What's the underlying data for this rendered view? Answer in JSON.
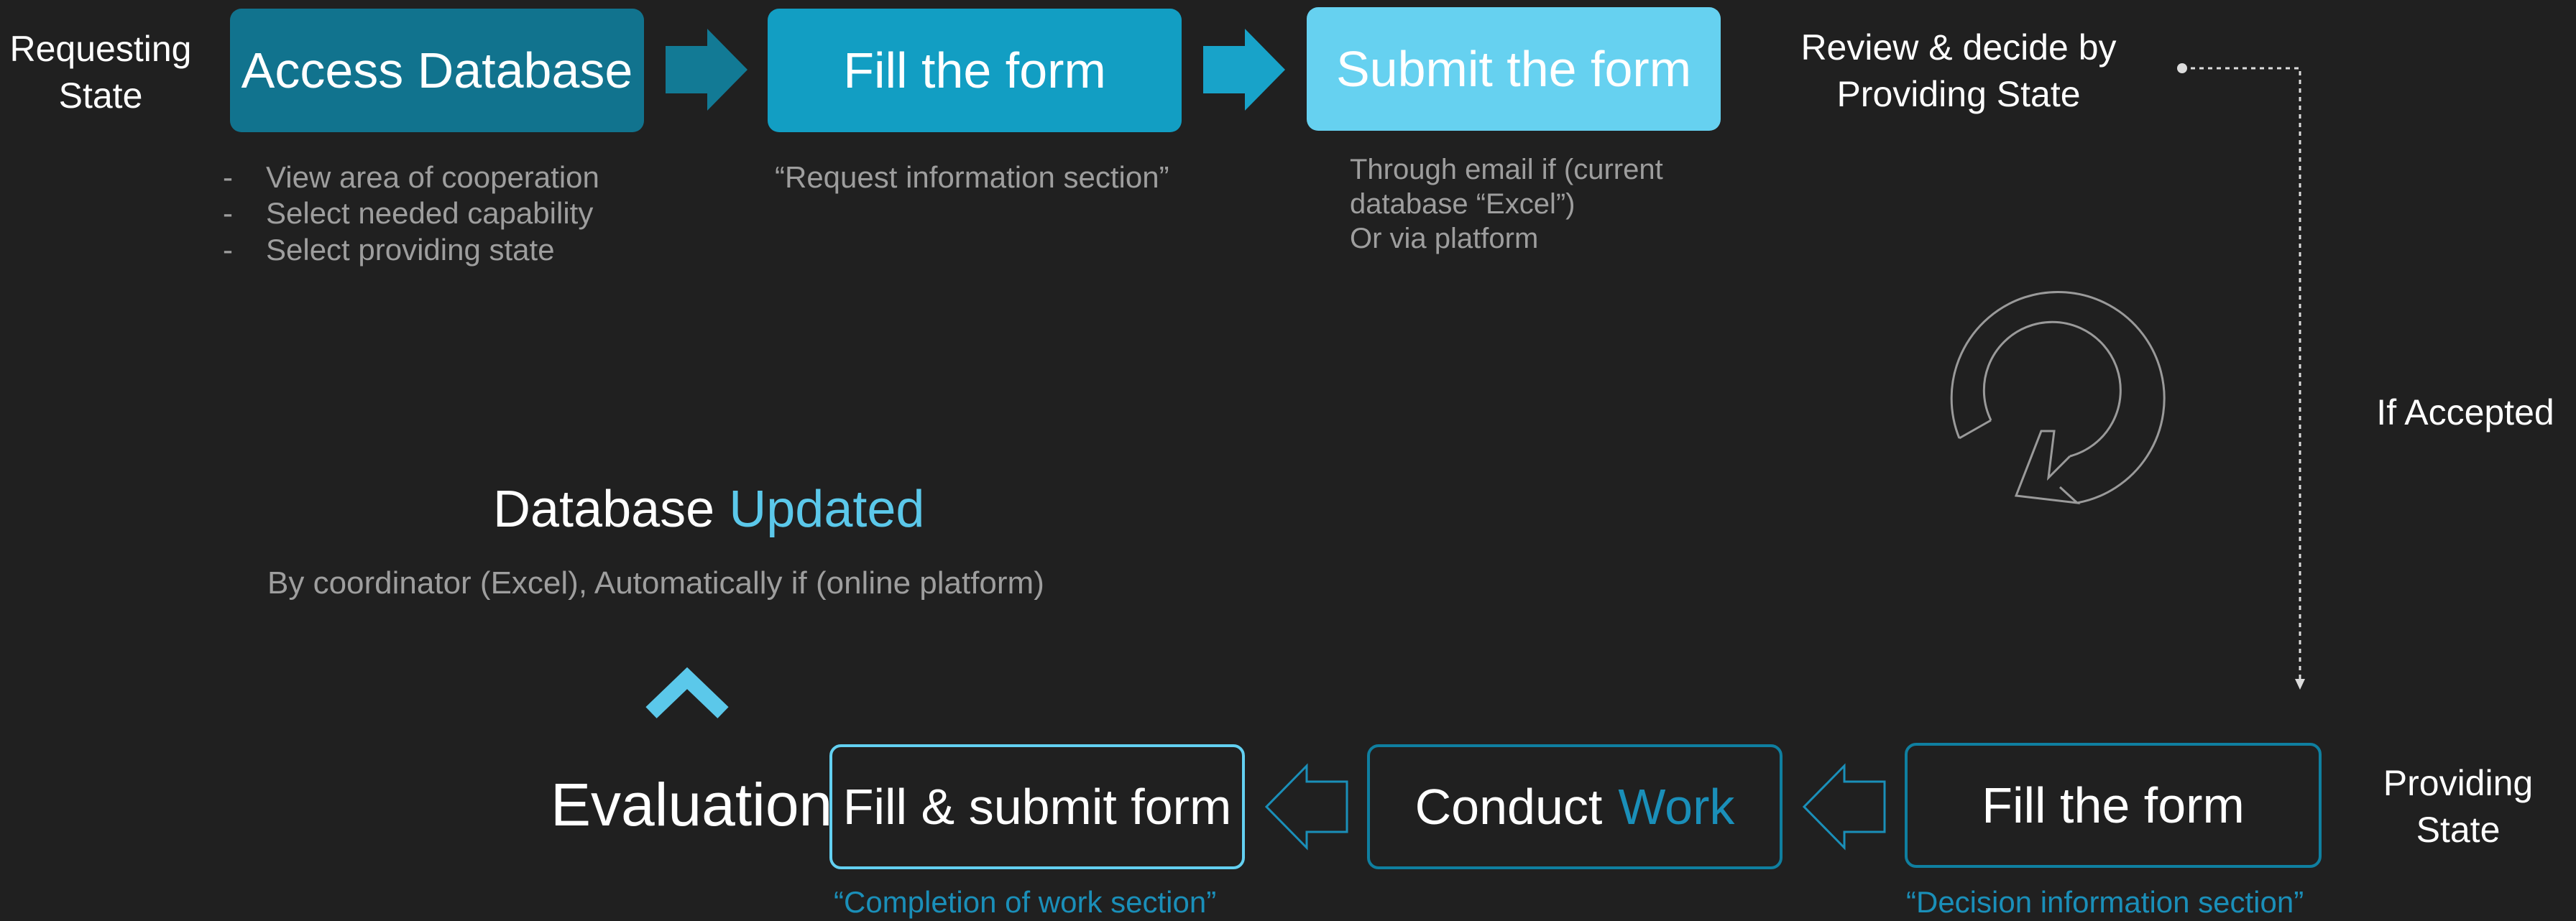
{
  "top_row": {
    "requesting_state": "Requesting\nState",
    "step1": {
      "label": "Access Database",
      "color": "#11738e"
    },
    "step2": {
      "label": "Fill the form",
      "color": "#129ec3"
    },
    "step3": {
      "label": "Submit the form",
      "color": "#66d1f0"
    },
    "step1_notes": [
      "View area of cooperation",
      "Select needed capability",
      "Select providing state"
    ],
    "step2_note": "“Request information section”",
    "step3_note": [
      "Through email if (current",
      "database “Excel”)",
      "Or via platform"
    ],
    "review": "Review & decide by\nProviding State"
  },
  "side": {
    "if_accepted": "If Accepted",
    "providing_state": "Providing\nState"
  },
  "database_updated": {
    "word1": "Database",
    "word2": "Updated",
    "note": "By coordinator (Excel), Automatically if (online platform)"
  },
  "bottom_row": {
    "evaluation": "Evaluation",
    "fill_submit": {
      "label": "Fill & submit form",
      "border": "#63d0f1"
    },
    "conduct": {
      "word1": "Conduct",
      "word2": "Work",
      "border": "#0f7fa0"
    },
    "fill_form": {
      "label": "Fill the form",
      "border": "#0f7fa0"
    },
    "fill_submit_note": "“Completion of work section”",
    "fill_form_note": "“Decision information section”"
  },
  "colors": {
    "background": "#202020",
    "accent_light": "#5bc8ea",
    "accent_mid": "#1a8fb9",
    "arrow_dark": "#127a95",
    "arrow_mid": "#18a3c9",
    "gray_text": "#9e9e9e",
    "cycle_icon": "#9a9a9a"
  },
  "icons": {
    "right_arrow": "right-arrow-icon",
    "left_arrow": "left-arrow-icon",
    "cycle": "refresh-cycle-icon",
    "chevron_up": "chevron-up-icon"
  }
}
